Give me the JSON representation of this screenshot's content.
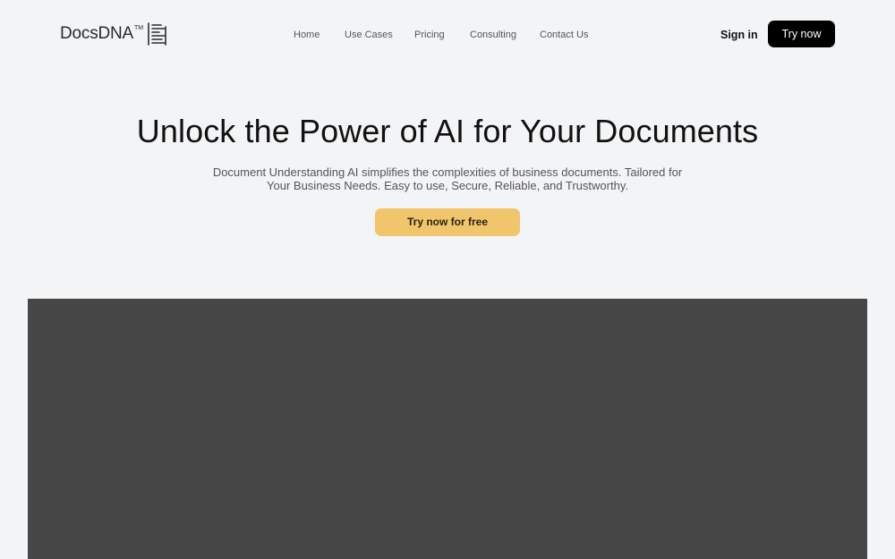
{
  "header": {
    "logo_text": "DocsDNA",
    "logo_tm": "TM",
    "nav": [
      "Home",
      "Use Cases",
      "Pricing",
      "Consulting",
      "Contact Us"
    ],
    "sign_in": "Sign in",
    "try_now": "Try now"
  },
  "hero": {
    "title": "Unlock the Power of AI for Your Documents",
    "subtitle": "Document Understanding AI simplifies the complexities of business documents. Tailored for Your Business Needs. Easy to use, Secure, Reliable, and Trustworthy.",
    "cta": "Try now for free"
  },
  "colors": {
    "background": "#f3f4f6",
    "primary_button": "#000000",
    "cta_button": "#f0c56b",
    "media_placeholder": "#464646"
  }
}
